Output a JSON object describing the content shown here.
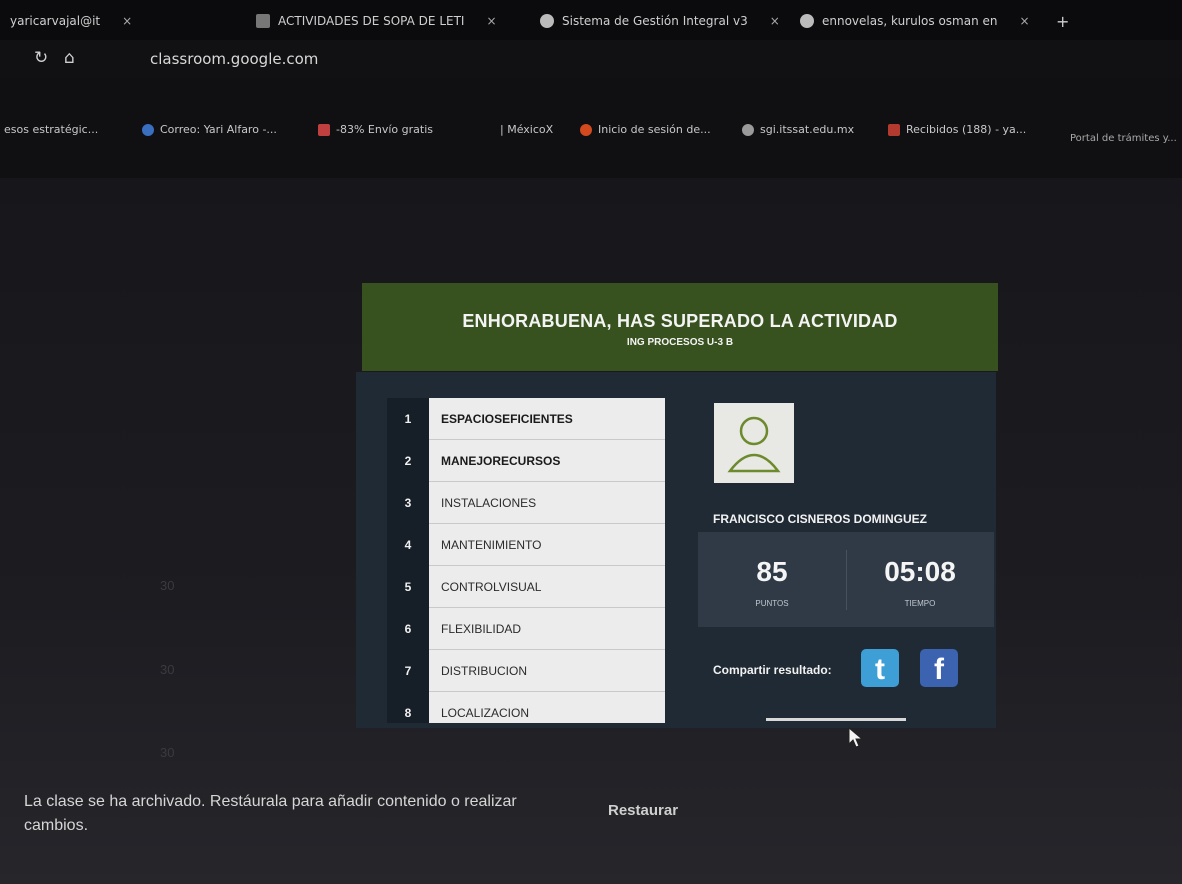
{
  "browser": {
    "tabs": [
      {
        "label": "yaricarvajal@it",
        "icon": "mail-icon"
      },
      {
        "label": "ACTIVIDADES DE SOPA DE LETI",
        "icon": "doc-icon"
      },
      {
        "label": "Sistema de Gestión Integral v3",
        "icon": "globe-icon"
      },
      {
        "label": "ennovelas, kurulos osman en",
        "icon": "copyright-icon"
      }
    ],
    "new_tab": "+",
    "close_tab": "×",
    "url": "classroom.google.com",
    "bookmarks": [
      {
        "label": "esos estratégic...",
        "icon": "link-icon"
      },
      {
        "label": "Correo: Yari Alfaro -...",
        "icon": "outlook-icon"
      },
      {
        "label": "-83% Envío gratis",
        "icon": "gift-icon"
      },
      {
        "label": "| MéxicoX",
        "icon": ""
      },
      {
        "label": "Inicio de sesión de...",
        "icon": "cpanel-icon"
      },
      {
        "label": "sgi.itssat.edu.mx",
        "icon": "globe-icon"
      },
      {
        "label": "Recibidos (188) - ya...",
        "icon": "gmail-icon"
      },
      {
        "label": "Portal de trámites y...",
        "icon": ""
      }
    ]
  },
  "result": {
    "title": "ENHORABUENA, HAS SUPERADO LA ACTIVIDAD",
    "subtitle": "ING PROCESOS U-3 B",
    "words": [
      {
        "num": "1",
        "text": "ESPACIOSEFICIENTES",
        "found": true
      },
      {
        "num": "2",
        "text": "MANEJORECURSOS",
        "found": true
      },
      {
        "num": "3",
        "text": "INSTALACIONES",
        "found": false
      },
      {
        "num": "4",
        "text": "MANTENIMIENTO",
        "found": false
      },
      {
        "num": "5",
        "text": "CONTROLVISUAL",
        "found": false
      },
      {
        "num": "6",
        "text": "FLEXIBILIDAD",
        "found": false
      },
      {
        "num": "7",
        "text": "DISTRIBUCION",
        "found": false
      },
      {
        "num": "8",
        "text": "LOCALIZACION",
        "found": false
      }
    ],
    "student_name": "FRANCISCO CISNEROS DOMINGUEZ",
    "score": {
      "value": "85",
      "label": "PUNTOS"
    },
    "time": {
      "value": "05:08",
      "label": "TIEMPO"
    },
    "share_label": "Compartir resultado:",
    "twitter_glyph": "t",
    "facebook_glyph": "f"
  },
  "classroom": {
    "archived_message": "La clase se ha archivado. Restáurala para añadir contenido o realizar cambios.",
    "restore_label": "Restaurar",
    "ghost_numbers": [
      "30",
      "30",
      "30"
    ]
  },
  "colors": {
    "header_green": "#38521f",
    "panel_navy": "#202a34",
    "twitter": "#3d9fd6",
    "facebook": "#3b63b0"
  }
}
